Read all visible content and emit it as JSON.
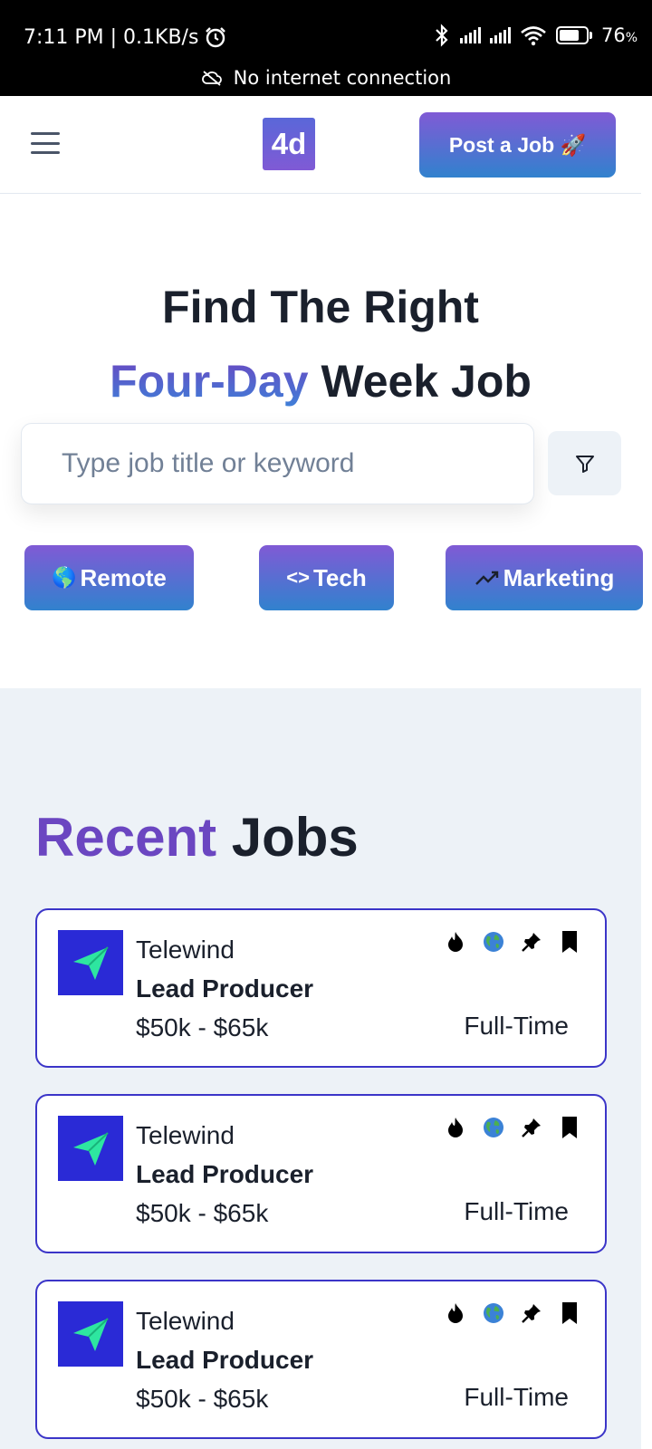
{
  "status_bar": {
    "time": "7:11 PM | 0.1KB/s",
    "battery": "76",
    "battery_unit": "%",
    "notice": "No internet connection"
  },
  "header": {
    "logo_text": "4d",
    "post_job_label": "Post a Job 🚀"
  },
  "hero": {
    "line1": "Find The Right",
    "accent": "Four-Day",
    "line2_rest": "Week Job",
    "search_placeholder": "Type job title or keyword"
  },
  "categories": [
    {
      "label": "Remote",
      "glyph": "🌎"
    },
    {
      "label": "Tech",
      "glyph": "<>"
    },
    {
      "label": "Marketing",
      "glyph": "↗"
    }
  ],
  "recent": {
    "title_accent": "Recent",
    "title_rest": "Jobs"
  },
  "jobs": [
    {
      "company": "Telewind",
      "title": "Lead Producer",
      "salary": "$50k - $65k",
      "type": "Full-Time"
    },
    {
      "company": "Telewind",
      "title": "Lead Producer",
      "salary": "$50k - $65k",
      "type": "Full-Time"
    },
    {
      "company": "Telewind",
      "title": "Lead Producer",
      "salary": "$50k - $65k",
      "type": "Full-Time"
    }
  ],
  "job_icons": [
    "fire-icon",
    "globe-icon",
    "pin-icon",
    "bookmark-icon"
  ],
  "colors": {
    "brand_purple": "#805ad5",
    "brand_blue": "#3182ce",
    "card_border": "#3b35c8",
    "job_logo_bg": "#2a2ad6",
    "job_logo_plane": "#2ee6a0"
  }
}
